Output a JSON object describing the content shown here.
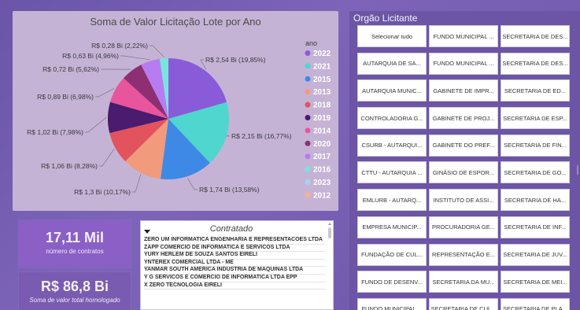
{
  "pie": {
    "title": "Soma de Valor Licitação Lote por Ano",
    "legend_title": "ano",
    "slices": [
      {
        "year": "2022",
        "label": "R$ 2,54 Bi (19,85%)",
        "pct": 19.85,
        "color": "#8a5bd9"
      },
      {
        "year": "2021",
        "label": "R$ 2,15 Bi (16,77%)",
        "pct": 16.77,
        "color": "#4fd6cf"
      },
      {
        "year": "2015",
        "label": "R$ 1,74 Bi (13,58%)",
        "pct": 13.58,
        "color": "#3f89e6"
      },
      {
        "year": "2013",
        "label": "R$ 1,3 Bi (10,17%)",
        "pct": 10.17,
        "color": "#f29a7c"
      },
      {
        "year": "2018",
        "label": "R$ 1,06 Bi (8,28%)",
        "pct": 8.28,
        "color": "#e2535d"
      },
      {
        "year": "2019",
        "label": "R$ 1,02 Bi (7,98%)",
        "pct": 7.98,
        "color": "#4a1b6e"
      },
      {
        "year": "2014",
        "label": "R$ 0,89 Bi (6,98%)",
        "pct": 6.98,
        "color": "#e8559c"
      },
      {
        "year": "2020",
        "label": "R$ 0,72 Bi (5,62%)",
        "pct": 5.62,
        "color": "#8e2f74"
      },
      {
        "year": "2017",
        "label": "R$ 0,63 Bi (4,96%)",
        "pct": 4.96,
        "color": "#b67cf0"
      },
      {
        "year": "2016",
        "label": "R$ 0,28 Bi (2,22%)",
        "pct": 2.22,
        "color": "#7be3df"
      }
    ],
    "legend": [
      {
        "year": "2022",
        "color": "#8a5bd9"
      },
      {
        "year": "2021",
        "color": "#4fd6cf"
      },
      {
        "year": "2015",
        "color": "#3f89e6"
      },
      {
        "year": "2013",
        "color": "#f29a7c"
      },
      {
        "year": "2018",
        "color": "#e2535d"
      },
      {
        "year": "2019",
        "color": "#4a1b6e"
      },
      {
        "year": "2014",
        "color": "#e8559c"
      },
      {
        "year": "2020",
        "color": "#8e2f74"
      },
      {
        "year": "2017",
        "color": "#b67cf0"
      },
      {
        "year": "2016",
        "color": "#7be3df"
      },
      {
        "year": "2023",
        "color": "#9fd7f2"
      },
      {
        "year": "2012",
        "color": "#f6b28f"
      }
    ]
  },
  "kpis": {
    "contratos_value": "17,11 Mil",
    "contratos_label": "número de contratos",
    "homologado_value": "R$ 86,8 Bi",
    "homologado_label": "Soma de valor total homologado"
  },
  "contratado": {
    "title": "Contratado",
    "items": [
      "ZERO UM INFORMATICA ENGENHARIA E REPRESENTACOES LTDA",
      "ZAPP COMERCIO DE INFORMATICA E SERVICOS LTDA",
      "YURY HERLEM DE SOUZA SANTOS EIRELI",
      "YNTEREX COMERCIAL LTDA - ME",
      "YANMAR SOUTH AMERICA INDUSTRIA DE MAQUINAS LTDA",
      "Y G SERVICOS E COMERCIO DE INFORMATICA LTDA EPP",
      "X ZERO TECNOLOGIA EIRELI"
    ]
  },
  "orgao": {
    "title": "Orgão Licitante",
    "buttons": [
      "Selecionar tudo",
      "FUNDO MUNICIPAL ...",
      "SECRETARIA DE DES...",
      "AUTARQUIA DE SA...",
      "FUNDO MUNICIPAL ...",
      "SECRETARIA DE DES...",
      "AUTARQUIA MUNIC...",
      "GABINETE DE IMPR...",
      "SECRETARIA DE ED...",
      "CONTROLADORIA G...",
      "GABINETE DE PROJ...",
      "SECRETARIA DE ESP...",
      "CSURB - AUTARQUI...",
      "GABINETE DO PREF...",
      "SECRETARIA DE FIN...",
      "CTTU - AUTARQUIA ...",
      "GINÁSIO DE ESPOR...",
      "SECRETARIA DE GO...",
      "EMLURB - AUTARQ...",
      "INSTITUTO DE ASSI...",
      "SECRETARIA DE HA...",
      "EMPRESA MUNICIP...",
      "PROCURADORIA GE...",
      "SECRETARIA DE INF...",
      "FUNDAÇÃO DE CUL...",
      "REPRESENTAÇÃO E...",
      "SECRETARIA DE JUV...",
      "FUNDO DE DESENV...",
      "SECRETARIA DA MU...",
      "SECRETARIA DE MEI...",
      "FUNDO MUNICIPAL ...",
      "SECRETARIA DE CUL...",
      "SECRETARIA DE PLA..."
    ]
  }
}
